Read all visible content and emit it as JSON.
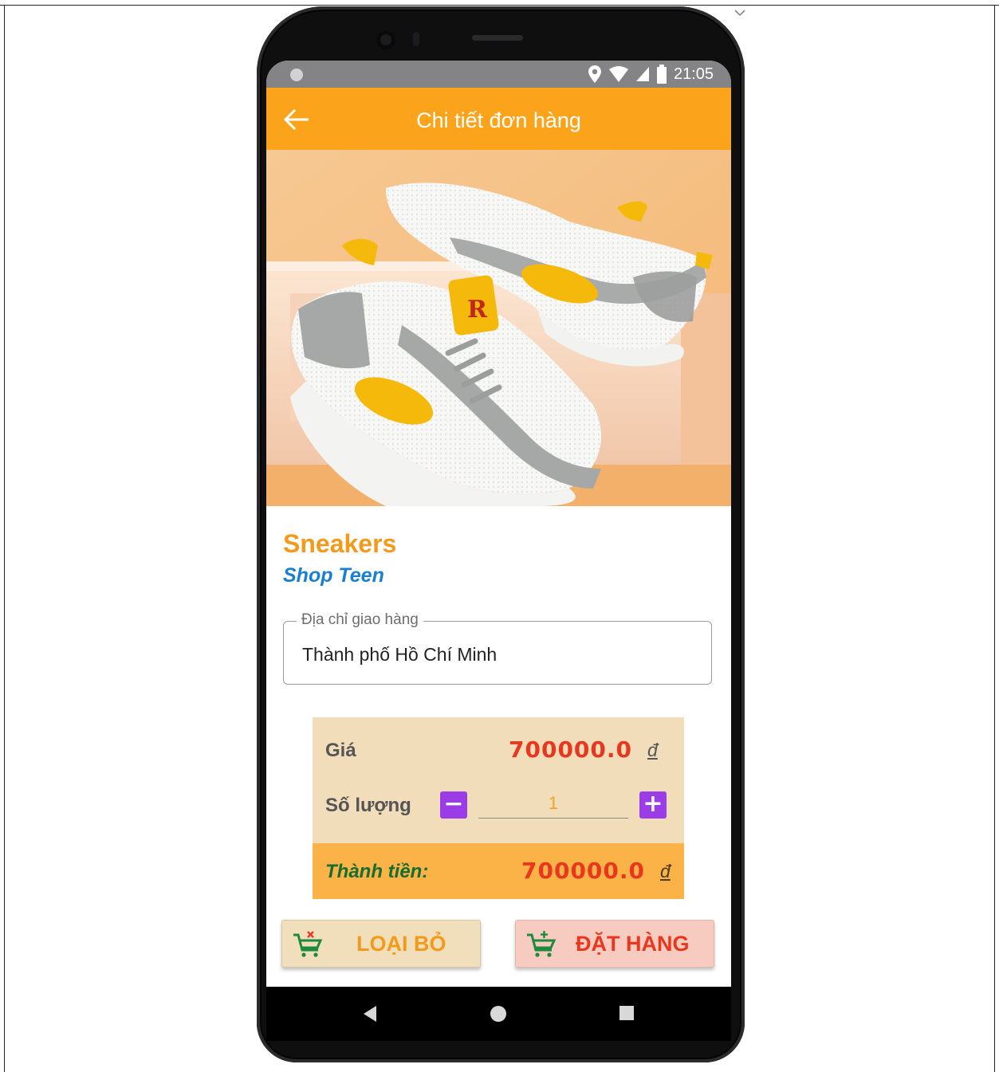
{
  "colors": {
    "accent": "#fba41b",
    "product_name": "#f39a1a",
    "shop_name": "#1a7fd0",
    "price": "#e8371e",
    "qty_button": "#9b3de6",
    "total_label": "#176c32",
    "panel_bg": "#f1ddb9",
    "total_bg": "#fbb347",
    "remove_button_bg": "#f1dfbb",
    "order_button_bg": "#f8cbc1"
  },
  "status_bar": {
    "time": "21:05",
    "icons": [
      "location-icon",
      "wifi-icon",
      "signal-icon",
      "battery-icon"
    ]
  },
  "app_bar": {
    "title": "Chi tiết đơn hàng",
    "back_icon": "back-arrow-icon"
  },
  "product": {
    "name": "Sneakers",
    "shop": "Shop Teen"
  },
  "address": {
    "label": "Địa chỉ giao hàng",
    "value": "Thành phố Hồ Chí Minh"
  },
  "pricing": {
    "price_label": "Giá",
    "price_value": "700000.0",
    "currency": "đ",
    "quantity_label": "Số lượng",
    "quantity_value": "1",
    "decrement_symbol": "−",
    "increment_symbol": "+",
    "total_label": "Thành tiền:",
    "total_value": "700000.0",
    "total_currency": "đ"
  },
  "actions": {
    "remove_label": "LOẠI BỎ",
    "remove_icon": "cart-remove-icon",
    "order_label": "ĐẶT HÀNG",
    "order_icon": "cart-add-icon"
  },
  "nav_bar": {
    "icons": [
      "nav-back-icon",
      "nav-home-icon",
      "nav-recents-icon"
    ]
  }
}
